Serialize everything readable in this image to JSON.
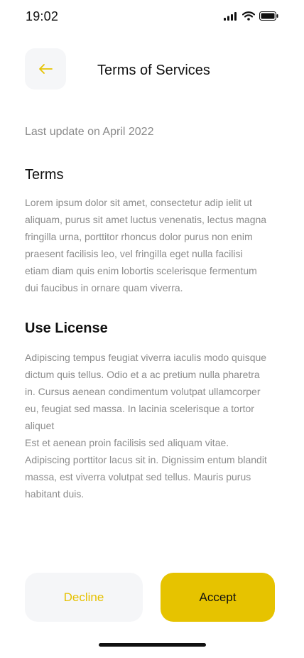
{
  "status_bar": {
    "time": "19:02",
    "icons": [
      "signal-icon",
      "wifi-icon",
      "battery-icon"
    ]
  },
  "header": {
    "back_icon": "arrow-left-icon",
    "title": "Terms of Services"
  },
  "last_update": "Last update on April 2022",
  "sections": [
    {
      "heading": "Terms",
      "lines": [
        "Lorem ipsum dolor sit amet, consectetur adip ielit ut",
        "aliquam, purus sit amet luctus venenatis, lectus magna",
        "fringilla urna, porttitor rhoncus dolor purus non enim",
        "praesent  facilisis leo, vel fringilla  eget nulla facilisi",
        "etiam diam quis enim lobortis scelerisque fermentum",
        "dui faucibus in ornare quam viverra."
      ]
    },
    {
      "heading": "Use License",
      "lines": [
        "Adipiscing tempus feugiat viverra iaculis modo quisque",
        "dictum quis tellus. Odio et a ac pretium nulla pharetra",
        "in. Cursus aenean condimentum volutpat ullamcorper",
        "eu, feugiat sed massa. In lacinia scelerisque a tortor",
        "aliquet",
        "Est et aenean proin facilisis sed aliquam vitae.",
        "Adipiscing porttitor lacus sit in. Dignissim entum blandit",
        "massa, est viverra volutpat sed tellus. Mauris purus",
        "habitant duis."
      ]
    }
  ],
  "actions": {
    "decline_label": "Decline",
    "accept_label": "Accept"
  },
  "colors": {
    "accent": "#E6C300",
    "button_secondary_bg": "#F5F6F8",
    "body_text": "#8C8C8C"
  }
}
